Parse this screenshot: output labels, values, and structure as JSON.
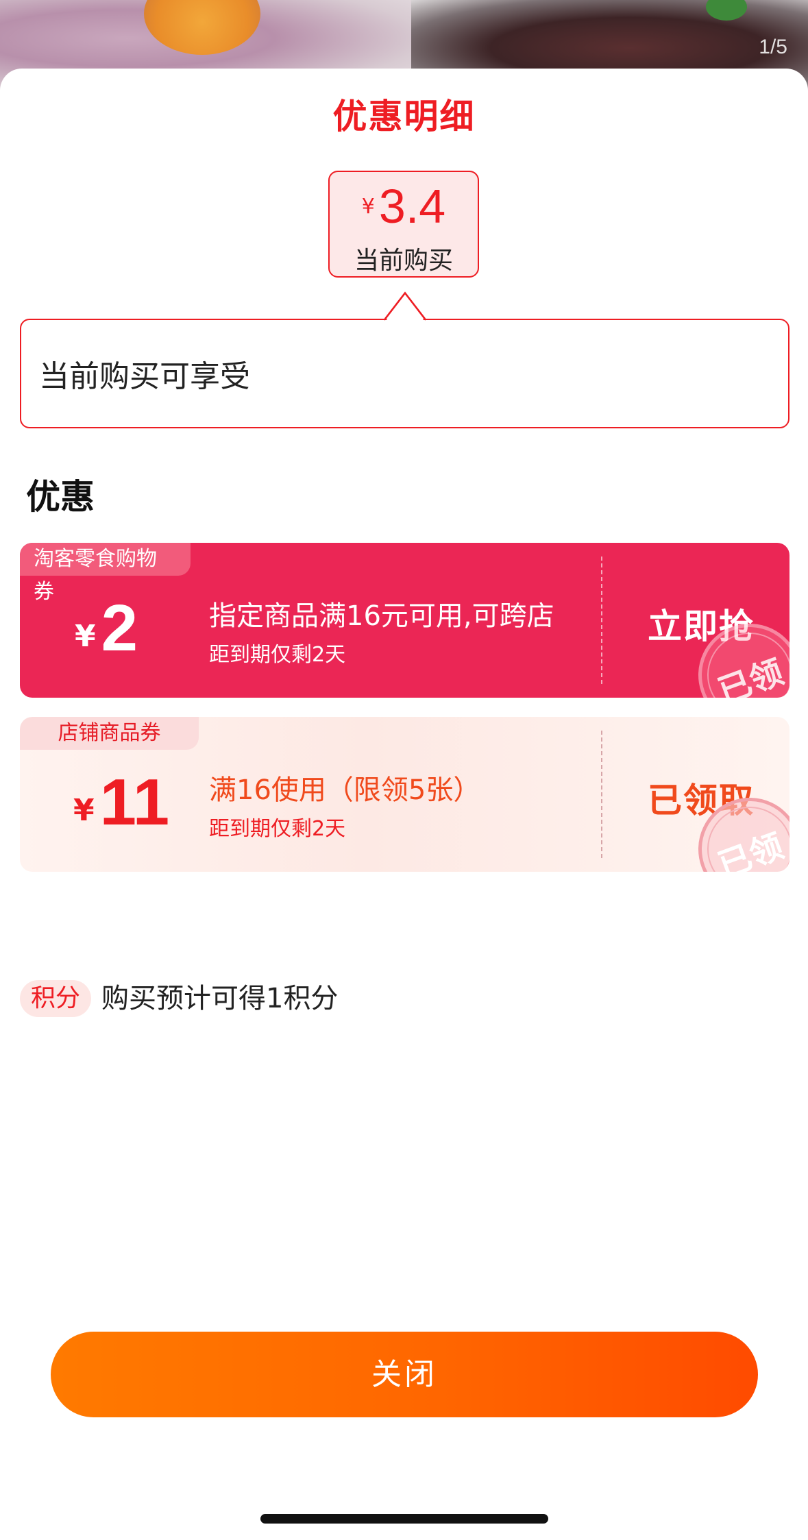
{
  "background": {
    "page_counter": "1/5"
  },
  "sheet": {
    "title": "优惠明细",
    "price": {
      "currency": "¥",
      "amount": "3.4",
      "caption": "当前购买"
    },
    "bubble_text": "当前购买可享受",
    "section_title": "优惠"
  },
  "coupons": [
    {
      "tag": "淘客零食购物券",
      "currency": "¥",
      "amount": "2",
      "description": "指定商品满16元可用,可跨店",
      "expiry": "距到期仅剩2天",
      "action": "立即抢",
      "stamp": "已领"
    },
    {
      "tag": "店铺商品券",
      "currency": "¥",
      "amount": "11",
      "description": "满16使用（限领5张）",
      "expiry": "距到期仅剩2天",
      "action": "已领取",
      "stamp": "已领"
    }
  ],
  "points": {
    "badge": "积分",
    "text": "购买预计可得1积分"
  },
  "close_button": "关闭",
  "colors": {
    "accent_red": "#ee1d23",
    "coupon_pink": "#eb2655",
    "button_orange": "#ff6600"
  }
}
